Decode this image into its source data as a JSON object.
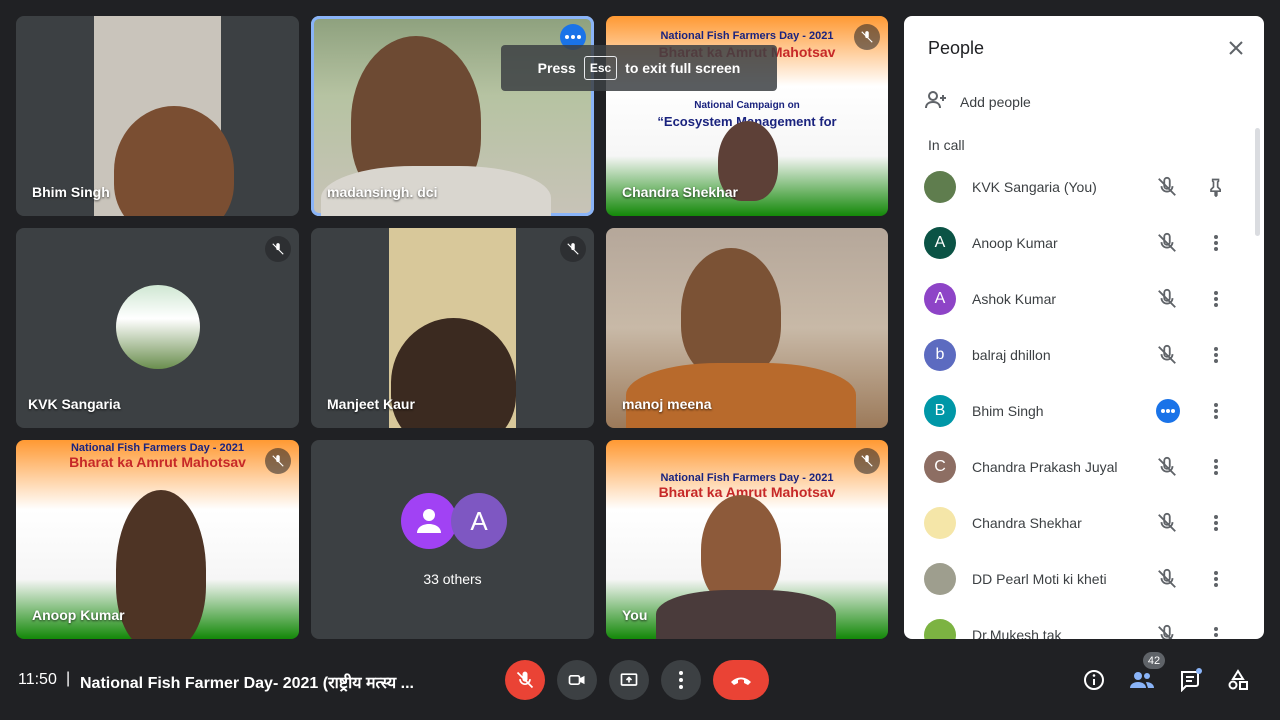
{
  "toast": {
    "press": "Press",
    "key": "Esc",
    "rest": "to exit full screen"
  },
  "tiles": {
    "t1": {
      "name": "Bhim Singh"
    },
    "t2": {
      "name": "madansingh. dci"
    },
    "t3": {
      "name": "Chandra Shekhar"
    },
    "t4": {
      "name": "KVK Sangaria"
    },
    "t5": {
      "name": "Manjeet Kaur"
    },
    "t6": {
      "name": "manoj meena"
    },
    "t7": {
      "name": "Anoop Kumar"
    },
    "t8": {
      "others": "33 others",
      "avatar_letter": "A"
    },
    "t9": {
      "name": "You"
    }
  },
  "banner": {
    "title": "National Fish Farmers Day - 2021",
    "mahotsav": "Bharat ka Amrut Mahotsav",
    "campaign": "National Campaign on",
    "eco": "“Ecosystem Management for"
  },
  "panel": {
    "title": "People",
    "add_people": "Add people",
    "in_call": "In call",
    "participants": [
      {
        "name": "KVK Sangaria (You)",
        "color": "#5f7d4e",
        "letter": ""
      },
      {
        "name": "Anoop Kumar",
        "color": "#0b5345",
        "letter": "A"
      },
      {
        "name": "Ashok Kumar",
        "color": "#8e44c7",
        "letter": "A"
      },
      {
        "name": "balraj dhillon",
        "color": "#5c6bc0",
        "letter": "b"
      },
      {
        "name": "Bhim Singh",
        "color": "#0097a7",
        "letter": "B"
      },
      {
        "name": "Chandra Prakash Juyal",
        "color": "#8d6e63",
        "letter": "C"
      },
      {
        "name": "Chandra Shekhar",
        "color": "#f5e6a8",
        "letter": ""
      },
      {
        "name": "DD Pearl Moti ki kheti",
        "color": "#9e9e8e",
        "letter": ""
      },
      {
        "name": "Dr.Mukesh tak",
        "color": "#7cb342",
        "letter": ""
      }
    ]
  },
  "bottom": {
    "time": "11:50",
    "separator": "|",
    "meeting_title": "National Fish Farmer Day- 2021 (राष्ट्रीय मत्स्य ...",
    "people_count": "42"
  },
  "colors": {
    "accent": "#1a73e8",
    "end_call": "#ea4335",
    "mic_off": "#ea4335",
    "bg": "#202124"
  }
}
